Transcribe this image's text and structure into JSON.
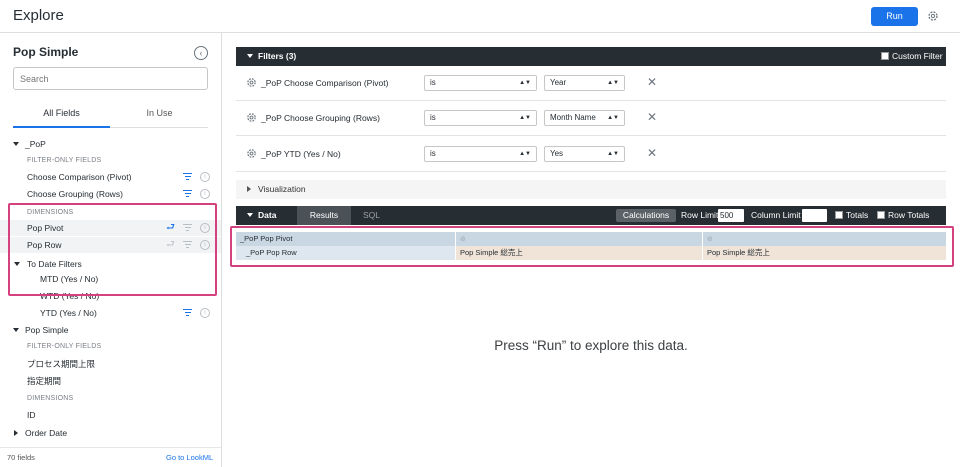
{
  "header": {
    "title": "Explore",
    "run_label": "Run"
  },
  "sidebar": {
    "model_title": "Pop Simple",
    "search_placeholder": "Search",
    "tabs": {
      "all_fields": "All Fields",
      "in_use": "In Use"
    },
    "views": [
      {
        "name": "_PoP",
        "filter_only_header": "FILTER-ONLY FIELDS",
        "filter_only": [
          "Choose Comparison (Pivot)",
          "Choose Grouping (Rows)"
        ],
        "dimensions_header": "DIMENSIONS",
        "dimensions": [
          "Pop Pivot",
          "Pop Row"
        ],
        "group": {
          "name": "To Date Filters",
          "items": [
            "MTD (Yes / No)",
            "WTD (Yes / No)",
            "YTD (Yes / No)"
          ]
        }
      },
      {
        "name": "Pop Simple",
        "filter_only_header": "FILTER-ONLY FIELDS",
        "filter_only": [
          "プロセス期間上限",
          "指定期間"
        ],
        "dimensions_header": "DIMENSIONS",
        "dimensions": [
          "ID",
          "Order Date"
        ]
      }
    ],
    "footer": {
      "field_count": "70 fields",
      "goto_lookml": "Go to LookML"
    }
  },
  "filters": {
    "title": "Filters (3)",
    "custom_filter_label": "Custom Filter",
    "rows": [
      {
        "name": "_PoP Choose Comparison (Pivot)",
        "operator": "is",
        "value": "Year"
      },
      {
        "name": "_PoP Choose Grouping (Rows)",
        "operator": "is",
        "value": "Month Name"
      },
      {
        "name": "_PoP YTD (Yes / No)",
        "operator": "is",
        "value": "Yes"
      }
    ]
  },
  "visualization": {
    "title": "Visualization"
  },
  "data": {
    "title": "Data",
    "tabs": {
      "results": "Results",
      "sql": "SQL"
    },
    "calculations_label": "Calculations",
    "row_limit_label": "Row Limit",
    "row_limit_value": "500",
    "column_limit_label": "Column Limit",
    "totals_label": "Totals",
    "row_totals_label": "Row Totals",
    "grid": {
      "pivot_header": "_PoP Pop Pivot",
      "pivot_dot": "⊘",
      "row_header": "_PoP Pop Row",
      "measures": [
        "Pop Simple 総売上",
        "Pop Simple 総売上"
      ]
    }
  },
  "empty_message": "Press “Run” to explore this data.",
  "colors": {
    "accent": "#1a73e8",
    "highlight": "#d4417e",
    "dark_bar": "#262d33"
  }
}
